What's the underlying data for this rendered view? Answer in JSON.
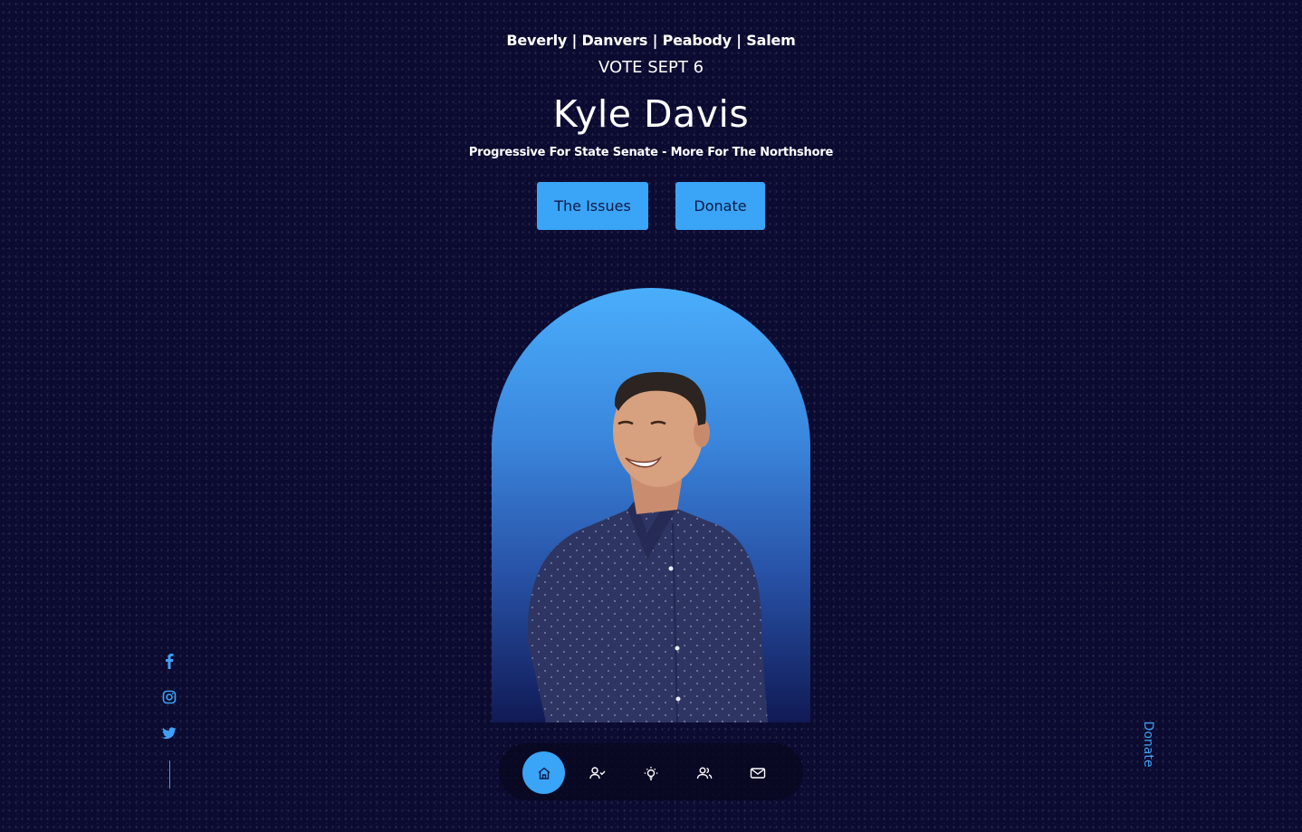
{
  "header": {
    "towns": "Beverly | Danvers | Peabody | Salem",
    "vote": "VOTE SEPT 6",
    "name": "Kyle Davis",
    "tagline": "Progressive For State Senate - More For The Northshore"
  },
  "buttons": {
    "issues": "The Issues",
    "donate": "Donate"
  },
  "social": [
    "facebook-icon",
    "instagram-icon",
    "twitter-icon"
  ],
  "side_link": "Donate",
  "nav": {
    "items": [
      "home-icon",
      "user-check-icon",
      "lightbulb-icon",
      "users-icon",
      "mail-icon"
    ],
    "active": "home-icon"
  },
  "colors": {
    "background": "#0b0a30",
    "accent": "#3aa4f7",
    "button_text": "#0e1a46"
  }
}
